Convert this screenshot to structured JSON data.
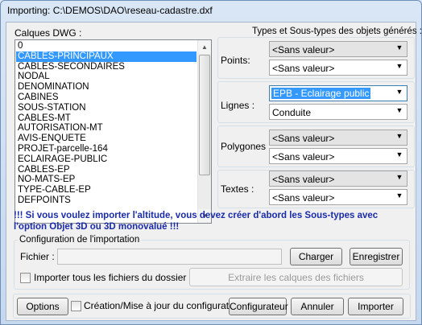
{
  "window": {
    "title": "Importing: C:\\DEMOS\\DAO\\reseau-cadastre.dxf"
  },
  "left": {
    "label": "Calques DWG :",
    "items": [
      "0",
      "CABLES-PRINCIPAUX",
      "CABLES-SECONDAIRES",
      "NODAL",
      "DENOMINATION",
      "CABINES",
      "SOUS-STATION",
      "CABLES-MT",
      "AUTORISATION-MT",
      "AVIS-ENQUETE",
      "PROJET-parcelle-164",
      "ECLAIRAGE-PUBLIC",
      "CABLES-EP",
      "NO-MATS-EP",
      "TYPE-CABLE-EP",
      "DEFPOINTS"
    ],
    "selected_index": 1
  },
  "right": {
    "header": "Types et Sous-types des objets générés :",
    "rows": [
      {
        "label": "Points:",
        "type": "<Sans valeur>",
        "subtype": "<Sans valeur>"
      },
      {
        "label": "Lignes :",
        "type": "EPB - Eclairage public",
        "subtype": "Conduite"
      },
      {
        "label": "Polygones :",
        "type": "<Sans valeur>",
        "subtype": "<Sans valeur>"
      },
      {
        "label": "Textes :",
        "type": "<Sans valeur>",
        "subtype": "<Sans valeur>"
      }
    ]
  },
  "warning": "!!! Si vous voulez importer l'altitude, vous devez créer d'abord les Sous-types avec l'option Objet 3D ou 3D monovalué !!!",
  "config": {
    "title": "Configuration de l'importation",
    "fichier_label": "Fichier :",
    "fichier_value": "",
    "charger": "Charger",
    "enregistrer": "Enregistrer",
    "import_all_label": "Importer tous les fichiers du dossier",
    "extraire": "Extraire les calques des fichiers"
  },
  "footer": {
    "options": "Options",
    "creation_label": "Création/Mise à jour du configurateur",
    "configurateur": "Configurateur",
    "annuler": "Annuler",
    "importer": "Importer"
  }
}
